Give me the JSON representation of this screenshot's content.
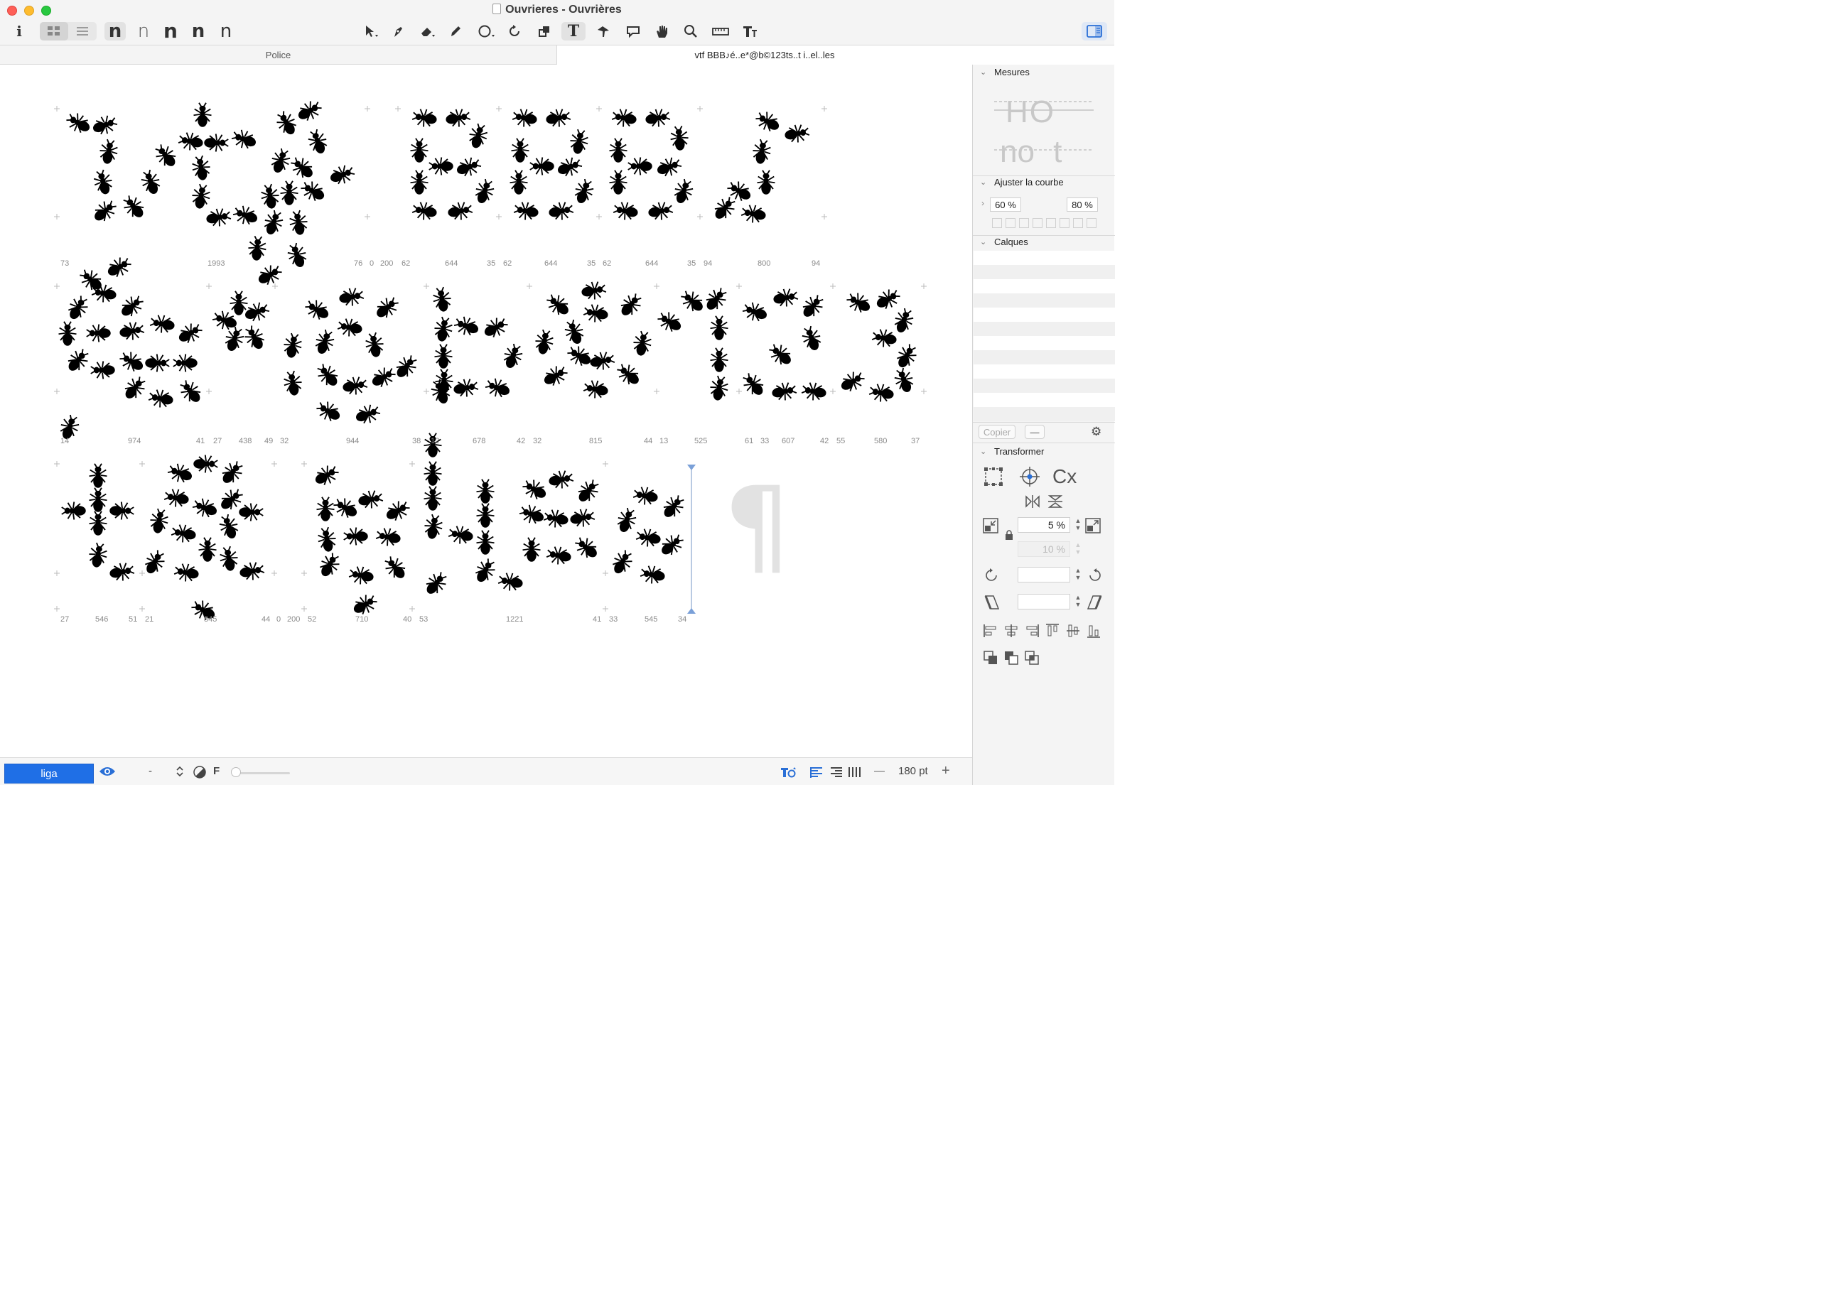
{
  "window": {
    "title": "Ouvrieres - Ouvrières"
  },
  "toolbar": {
    "info_label": "i",
    "glyph_buttons": [
      "n",
      "n",
      "n",
      "n",
      "n"
    ],
    "tools": [
      "select-arrow-icon",
      "pen-icon",
      "eraser-icon",
      "pencil-icon",
      "ellipse-icon",
      "rotate-icon",
      "scale-icon",
      "text-tool-icon",
      "knife-icon",
      "annotation-icon",
      "hand-icon",
      "zoom-icon",
      "measure-icon",
      "metrics-tool-icon"
    ],
    "text_tool_label": "T"
  },
  "tabs": {
    "left": "Police",
    "right": "vtf BBB♪é..e*@b©123ts..t i..el..les"
  },
  "canvas": {
    "row1": [
      "73",
      "1993",
      "76",
      "0",
      "200",
      "62",
      "644",
      "35",
      "62",
      "644",
      "35",
      "62",
      "644",
      "35",
      "94",
      "800",
      "94"
    ],
    "row2": [
      "14",
      "974",
      "41",
      "27",
      "438",
      "49",
      "32",
      "944",
      "38",
      "12",
      "678",
      "42",
      "32",
      "815",
      "44",
      "13",
      "525",
      "61",
      "33",
      "607",
      "42",
      "55",
      "580",
      "37"
    ],
    "row3": [
      "27",
      "546",
      "51",
      "21",
      "845",
      "44",
      "0",
      "200",
      "52",
      "710",
      "40",
      "53",
      "1221",
      "41",
      "33",
      "545",
      "34"
    ],
    "pilcrow": "¶"
  },
  "inspector": {
    "mesures_title": "Mesures",
    "preview_top": "HO",
    "preview_bottom": "no t",
    "ajuster_title": "Ajuster la courbe",
    "curve_values": [
      "60 %",
      "80 %"
    ],
    "calques_title": "Calques",
    "copier_label": "Copier",
    "minus_label": "—",
    "transformer_title": "Transformer",
    "cx_label": "Cx",
    "scale_value": "5 %",
    "scale_value_disabled": "10 %"
  },
  "bottombar": {
    "liga_label": "liga",
    "dash_label": "-",
    "f_label": "F",
    "size_value": "180 pt",
    "minus": "—",
    "plus": "+",
    "slider_value": 0
  }
}
